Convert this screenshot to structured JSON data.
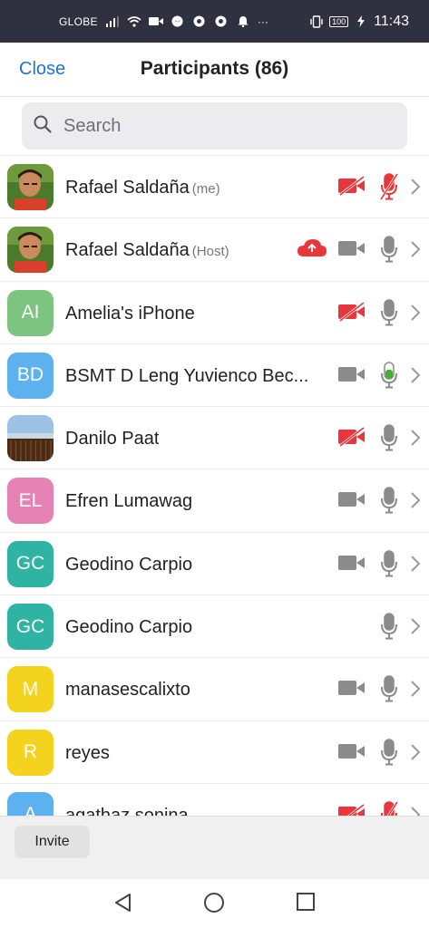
{
  "status_bar": {
    "carrier": "GLOBE",
    "dots": "···",
    "battery": "100",
    "time": "11:43",
    "icons": [
      "signal-icon",
      "wifi-icon",
      "video-icon",
      "messenger-icon",
      "chrome-icon",
      "chrome-icon",
      "notification-icon"
    ]
  },
  "header": {
    "close_label": "Close",
    "title": "Participants (86)"
  },
  "search": {
    "placeholder": "Search"
  },
  "participants": [
    {
      "name": "Rafael Saldaña",
      "tag": "(me)",
      "avatar_type": "photo",
      "initials": "",
      "avatar_color": "",
      "cloud": false,
      "video": "off",
      "mic": "off"
    },
    {
      "name": "Rafael Saldaña",
      "tag": "(Host)",
      "avatar_type": "photo",
      "initials": "",
      "avatar_color": "",
      "cloud": true,
      "video": "on",
      "mic": "idle"
    },
    {
      "name": "Amelia's iPhone",
      "tag": "",
      "avatar_type": "initials",
      "initials": "AI",
      "avatar_color": "#7cc47f",
      "cloud": false,
      "video": "off",
      "mic": "idle"
    },
    {
      "name": "BSMT D Leng Yuvienco Bec...",
      "tag": "",
      "avatar_type": "initials",
      "initials": "BD",
      "avatar_color": "#5cb1ee",
      "cloud": false,
      "video": "on",
      "mic": "active"
    },
    {
      "name": "Danilo Paat",
      "tag": "",
      "avatar_type": "landscape",
      "initials": "",
      "avatar_color": "",
      "cloud": false,
      "video": "off",
      "mic": "idle"
    },
    {
      "name": "Efren Lumawag",
      "tag": "",
      "avatar_type": "initials",
      "initials": "EL",
      "avatar_color": "#e681b5",
      "cloud": false,
      "video": "on",
      "mic": "idle"
    },
    {
      "name": "Geodino Carpio",
      "tag": "",
      "avatar_type": "initials",
      "initials": "GC",
      "avatar_color": "#2fb3a3",
      "cloud": false,
      "video": "on",
      "mic": "idle"
    },
    {
      "name": "Geodino Carpio",
      "tag": "",
      "avatar_type": "initials",
      "initials": "GC",
      "avatar_color": "#2fb3a3",
      "cloud": false,
      "video": "none",
      "mic": "idle"
    },
    {
      "name": "manasescalixto",
      "tag": "",
      "avatar_type": "initials",
      "initials": "M",
      "avatar_color": "#f4d31e",
      "cloud": false,
      "video": "on",
      "mic": "idle"
    },
    {
      "name": "reyes",
      "tag": "",
      "avatar_type": "initials",
      "initials": "R",
      "avatar_color": "#f4d31e",
      "cloud": false,
      "video": "on",
      "mic": "idle"
    },
    {
      "name": "agathaz sonina",
      "tag": "",
      "avatar_type": "initials",
      "initials": "A",
      "avatar_color": "#5cb1ee",
      "cloud": false,
      "video": "off",
      "mic": "off"
    }
  ],
  "bottom": {
    "invite_label": "Invite"
  },
  "colors": {
    "accent_blue": "#1e73d8",
    "muted_red": "#e8363b",
    "active_green": "#43b02a",
    "icon_gray": "#8b8b8b"
  },
  "nav": [
    "back-icon",
    "home-icon",
    "recents-icon"
  ]
}
